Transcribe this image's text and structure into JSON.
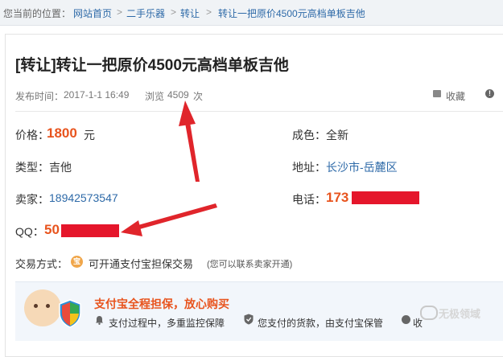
{
  "breadcrumb": {
    "prefix": "您当前的位置：",
    "items": [
      "网站首页",
      "二手乐器",
      "转让",
      "转让一把原价4500元高档单板吉他"
    ],
    "separator": ">"
  },
  "listing": {
    "title": "[转让]转让一把原价4500元高档单板吉他",
    "publish_label": "发布时间：",
    "publish_time": "2017-1-1 16:49",
    "views_label": "浏览",
    "views_count": "4509",
    "views_unit": "次",
    "favorite_label": "收藏"
  },
  "details": {
    "price_label": "价格：",
    "price_value": "1800",
    "price_unit": "元",
    "condition_label": "成色：",
    "condition_value": "全新",
    "type_label": "类型：",
    "type_value": "吉他",
    "address_label": "地址：",
    "address_value": "长沙市-岳麓区",
    "seller_label": "卖家：",
    "seller_value": "18942573547",
    "phone_label": "电话：",
    "phone_value": "173",
    "qq_label": "QQ：",
    "qq_value": "50"
  },
  "trade": {
    "label": "交易方式：",
    "text": "可开通支付宝担保交易",
    "note": "(您可以联系卖家开通)"
  },
  "banner": {
    "title": "支付宝全程担保，放心购买",
    "item1": "支付过程中，多重监控保障",
    "item2": "您支付的货款，由支付宝保管",
    "item3_partial": "收"
  },
  "watermark": {
    "text": "无极领域"
  },
  "colors": {
    "accent": "#e8541e",
    "link": "#2e6aa8",
    "redaction": "#e5162b",
    "annotation_arrow": "#e0252b"
  }
}
